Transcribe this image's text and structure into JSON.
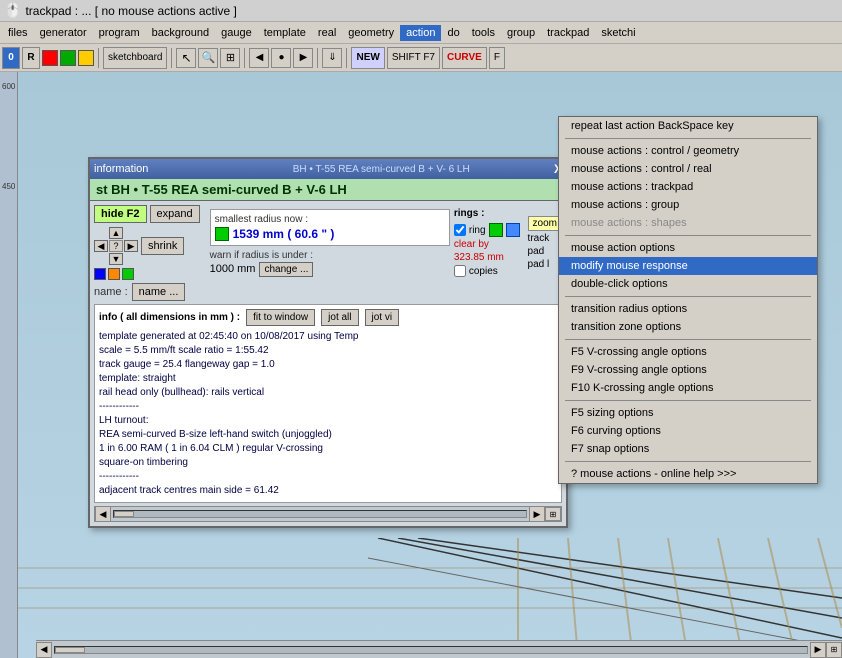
{
  "titlebar": {
    "text": "trackpad : ...   [ no mouse actions active ]",
    "icon": "🖱️"
  },
  "menubar": {
    "items": [
      {
        "label": "files",
        "id": "files"
      },
      {
        "label": "generator",
        "id": "generator"
      },
      {
        "label": "program",
        "id": "program"
      },
      {
        "label": "background",
        "id": "background"
      },
      {
        "label": "gauge",
        "id": "gauge"
      },
      {
        "label": "template",
        "id": "template"
      },
      {
        "label": "real",
        "id": "real"
      },
      {
        "label": "geometry",
        "id": "geometry"
      },
      {
        "label": "action",
        "id": "action",
        "active": true
      },
      {
        "label": "do",
        "id": "do"
      },
      {
        "label": "tools",
        "id": "tools"
      },
      {
        "label": "group",
        "id": "group"
      },
      {
        "label": "trackpad",
        "id": "trackpad"
      },
      {
        "label": "sketchi",
        "id": "sketchi"
      }
    ]
  },
  "toolbar": {
    "zero_btn": "0",
    "r_btn": "R",
    "sketchboard_btn": "sketchboard",
    "new_btn": "NEW",
    "shift_f7": "SHIFT F7",
    "curve_label": "CURVE",
    "f_label": "F"
  },
  "dialog": {
    "titlebar": "information",
    "info_bar": "BH • T-55  REA semi-curved B + V- 6  LH",
    "header": "st   BH • T-55  REA semi-curved B + V-6  LH",
    "close_btn": "X",
    "hide_btn": "hide F2",
    "expand_btn": "expand",
    "shrink_btn": "shrink",
    "name_btn": "name ...",
    "name_label": "name :",
    "smallest_radius_label": "smallest radius now :",
    "radius_value": "1539 mm ( 60.6 \" )",
    "warn_label": "warn if radius is under :",
    "warn_value": "1000 mm",
    "change_btn": "change ...",
    "rings_label": "rings :",
    "ring_label": "ring",
    "clear_by_label": "clear by",
    "clear_value": "323.85 mm",
    "copies_label": "copies",
    "zoom_btn": "zoom",
    "track_label": "track",
    "pad_label1": "pad",
    "pad_label2": "pad l",
    "info_dims_label": "info ( all dimensions in mm ) :",
    "fit_btn": "fit to window",
    "jot_btn": "jot all",
    "jot_vi_btn": "jot vi",
    "info_lines": [
      "template generated at 02:45:40 on 10/08/2017 using Temp",
      "scale = 5.5 mm/ft      scale ratio = 1:55.42",
      "track gauge = 25.4    flangeway gap = 1.0",
      "template: straight",
      "rail head only (bullhead): rails vertical",
      "------------",
      "LH turnout:",
      "REA semi-curved  B-size left-hand switch (unjoggled)",
      "1 in 6.00 RAM  ( 1 in 6.04 CLM ) regular V-crossing",
      "square-on timbering",
      "------------",
      "adjacent track centres main side = 61.42",
      "..."
    ]
  },
  "dropdown": {
    "items": [
      {
        "label": "repeat last action    BackSpace key",
        "id": "repeat",
        "type": "item"
      },
      {
        "type": "sep"
      },
      {
        "label": "mouse actions :  control / geometry",
        "id": "ma-geometry",
        "type": "item"
      },
      {
        "label": "mouse actions :  control / real",
        "id": "ma-real",
        "type": "item"
      },
      {
        "label": "mouse actions :  trackpad",
        "id": "ma-trackpad",
        "type": "item"
      },
      {
        "label": "mouse actions :  group",
        "id": "ma-group",
        "type": "item"
      },
      {
        "label": "mouse actions :  shapes",
        "id": "ma-shapes",
        "type": "item",
        "disabled": true
      },
      {
        "type": "sep"
      },
      {
        "label": "mouse action options",
        "id": "ma-options",
        "type": "item"
      },
      {
        "label": "modify mouse response",
        "id": "modify-mouse",
        "type": "item",
        "selected": true
      },
      {
        "label": "double-click options",
        "id": "dbl-click",
        "type": "item"
      },
      {
        "type": "sep"
      },
      {
        "label": "transition radius options",
        "id": "tr-radius",
        "type": "item"
      },
      {
        "label": "transition zone options",
        "id": "tr-zone",
        "type": "item"
      },
      {
        "type": "sep"
      },
      {
        "label": "F5  V-crossing angle options",
        "id": "f5-vcross",
        "type": "item"
      },
      {
        "label": "F9  V-crossing angle options",
        "id": "f9-vcross",
        "type": "item"
      },
      {
        "label": "F10  K-crossing angle options",
        "id": "f10-kcross",
        "type": "item"
      },
      {
        "type": "sep"
      },
      {
        "label": "F5  sizing options",
        "id": "f5-sizing",
        "type": "item"
      },
      {
        "label": "F6  curving options",
        "id": "f6-curving",
        "type": "item"
      },
      {
        "label": "F7  snap options",
        "id": "f7-snap",
        "type": "item"
      },
      {
        "type": "sep"
      },
      {
        "label": "? mouse actions - online  help  >>>",
        "id": "help",
        "type": "item"
      }
    ]
  },
  "ruler": {
    "marks": [
      "600",
      "450"
    ]
  },
  "colors": {
    "accent_blue": "#316ac5",
    "menu_bg": "#d4d0c8",
    "dialog_header_bg": "#b0e0b0",
    "dialog_header_text": "#003300",
    "info_text": "#000044",
    "radius_text": "#0000cc",
    "selected_menu": "#316ac5"
  }
}
